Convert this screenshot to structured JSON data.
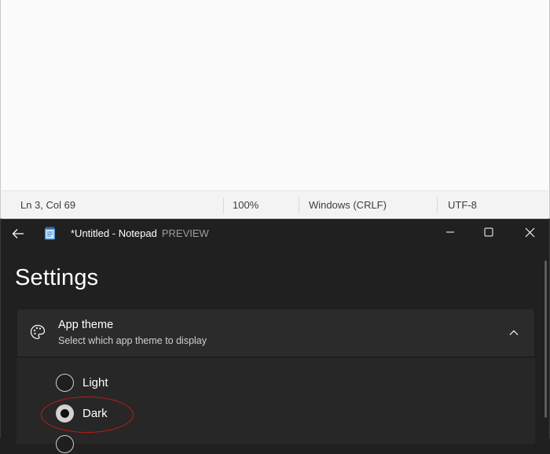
{
  "light_window": {
    "status": {
      "position": "Ln 3, Col 69",
      "zoom": "100%",
      "line_ending": "Windows (CRLF)",
      "encoding": "UTF-8"
    }
  },
  "dark_window": {
    "title": "*Untitled - Notepad",
    "title_suffix": "PREVIEW",
    "page_heading": "Settings",
    "theme_card": {
      "title": "App theme",
      "subtitle": "Select which app theme to display",
      "expanded": true
    },
    "theme_options": [
      {
        "label": "Light",
        "selected": false
      },
      {
        "label": "Dark",
        "selected": true
      }
    ],
    "highlight_color": "#c41a1a"
  },
  "icons": {
    "back": "back-arrow-icon",
    "app": "notepad-app-icon",
    "minimize": "minimize-icon",
    "maximize": "maximize-icon",
    "close": "close-icon",
    "palette": "palette-icon",
    "chevron": "chevron-up-icon"
  }
}
